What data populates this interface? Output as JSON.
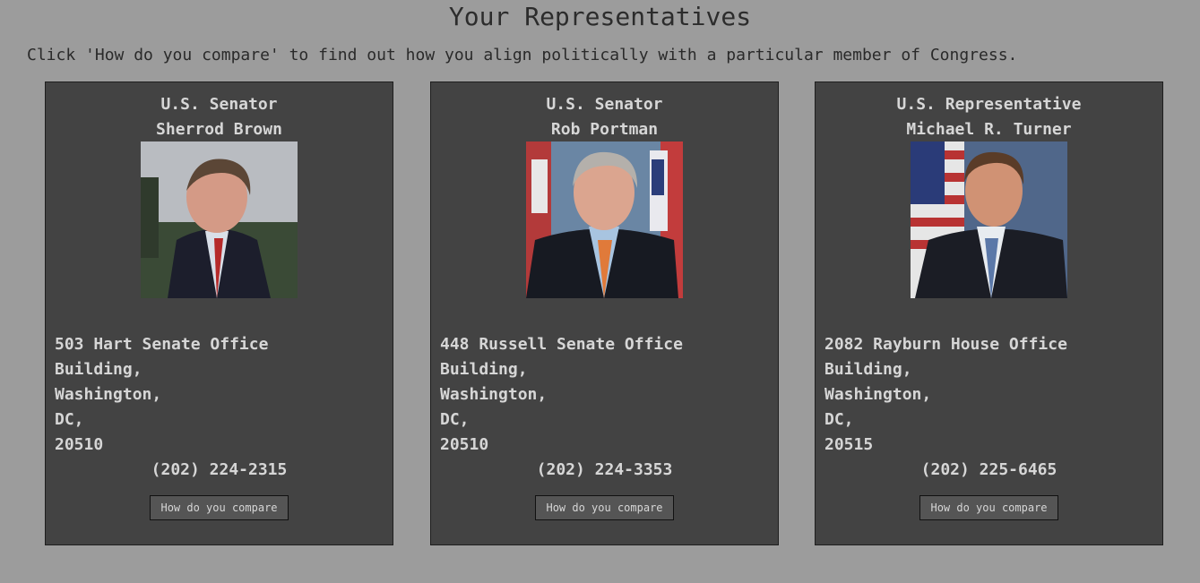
{
  "header": {
    "title": "Your Representatives",
    "subtitle": "Click 'How do you compare' to find out how you align politically with a particular member of Congress."
  },
  "cards": [
    {
      "role": "U.S. Senator",
      "name": "Sherrod Brown",
      "address": [
        "503 Hart Senate Office",
        "Building,",
        "Washington,",
        "DC,",
        "20510"
      ],
      "phone": "(202) 224-2315",
      "button": "How do you compare",
      "photo_alt": "Portrait of Sherrod Brown"
    },
    {
      "role": "U.S. Senator",
      "name": "Rob Portman",
      "address": [
        "448 Russell Senate Office",
        "Building,",
        "Washington,",
        "DC,",
        "20510"
      ],
      "phone": "(202) 224-3353",
      "button": "How do you compare",
      "photo_alt": "Portrait of Rob Portman"
    },
    {
      "role": "U.S. Representative",
      "name": "Michael R. Turner",
      "address": [
        "2082 Rayburn House Office",
        "Building,",
        "Washington,",
        "DC,",
        "20515"
      ],
      "phone": "(202) 225-6465",
      "button": "How do you compare",
      "photo_alt": "Portrait of Michael R. Turner"
    }
  ],
  "colors": {
    "page_background": "#9c9c9c",
    "card_background": "#434343",
    "card_text": "#d6d6d6"
  }
}
